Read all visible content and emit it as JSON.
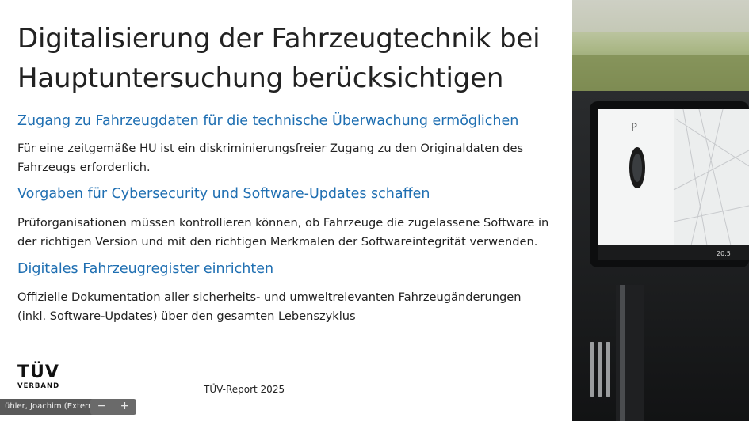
{
  "slide": {
    "title_line1": "Digitalisierung der Fahrzeugtechnik bei",
    "title_line2": "Hauptuntersuchung berücksichtigen",
    "sections": [
      {
        "heading": "Zugang zu Fahrzeugdaten für die technische Überwachung ermöglichen",
        "line1": "Für eine zeitgemäße HU ist ein diskriminierungsfreier Zugang zu den Originaldaten des",
        "line2": "Fahrzeugs erforderlich."
      },
      {
        "heading": "Vorgaben für Cybersecurity und Software-Updates schaffen",
        "line1": "Prüforganisationen müssen kontrollieren können, ob Fahrzeuge die zugelassene Software in",
        "line2": "der richtigen Version und mit den richtigen Merkmalen der Softwareintegrität verwenden."
      },
      {
        "heading": "Digitales Fahrzeugregister einrichten",
        "line1": "Offizielle Dokumentation aller sicherheits- und umweltrelevanten Fahrzeugänderungen",
        "line2": "(inkl. Software-Updates) über den gesamten Lebenszyklus"
      }
    ],
    "logo_top": "TÜV",
    "logo_bottom": "VERBAND",
    "footer": "TÜV-Report 2025"
  },
  "photo": {
    "gear": "P",
    "speed": "20.5"
  },
  "meeting": {
    "participant": "ühler, Joachim (Extern)",
    "zoom_out": "−",
    "zoom_in": "+"
  }
}
